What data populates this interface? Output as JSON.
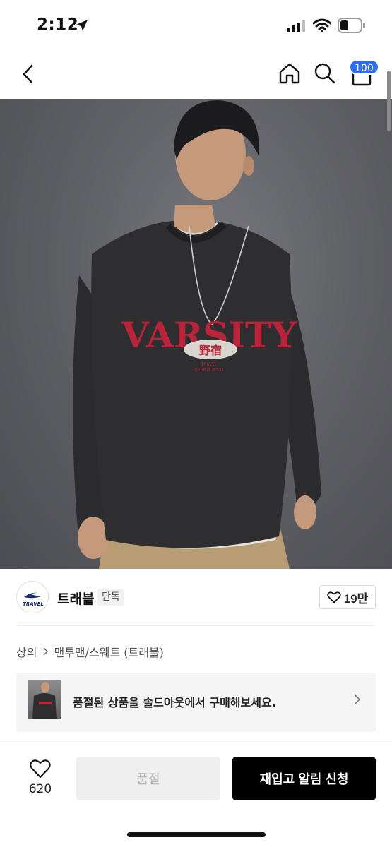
{
  "status_bar": {
    "time": "2:12"
  },
  "nav": {
    "back_icon": "chevron-left-icon",
    "home_icon": "home-icon",
    "search_icon": "search-icon",
    "cart_icon": "cart-icon",
    "cart_badge": "100",
    "badge_color": "#2f6bf0"
  },
  "hero": {
    "sweatshirt_print_main": "VARSITY",
    "sweatshirt_print_oval": "野宿",
    "sweatshirt_print_small_1": "TRAVEL",
    "sweatshirt_print_small_2": "KEEP IT WILD",
    "print_color": "#b8243a"
  },
  "brand": {
    "logo_text": "TRAVEL",
    "name": "트래블",
    "exclusive_label": "단독",
    "like_count": "19만"
  },
  "breadcrumb": {
    "items": [
      "상의",
      "맨투맨/스웨트 (트래블)"
    ]
  },
  "soldout_banner": {
    "text": "품절된 상품을 솔드아웃에서 구매해보세요."
  },
  "bottom_bar": {
    "wish_count": "620",
    "soldout_label": "품절",
    "restock_label": "재입고 알림 신청"
  }
}
